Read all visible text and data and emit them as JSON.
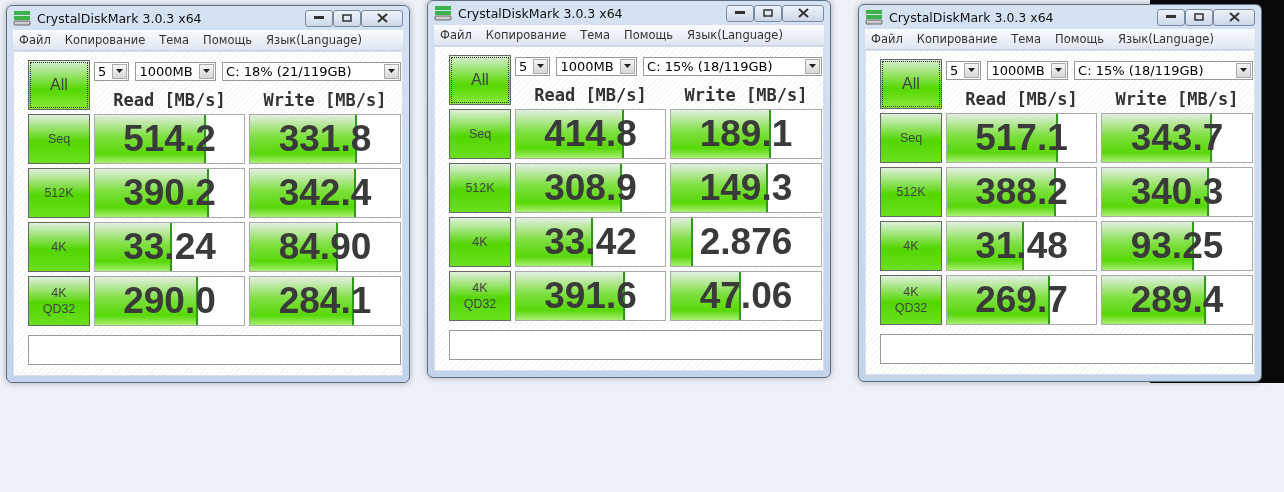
{
  "windows": [
    {
      "title": "CrystalDiskMark 3.0.3 x64",
      "menu": [
        "Файл",
        "Копирование",
        "Тема",
        "Помощь",
        "Язык(Language)"
      ],
      "all_button": "All",
      "count": "5",
      "size": "1000MB",
      "drive": "C: 18% (21/119GB)",
      "headers": [
        "Read [MB/s]",
        "Write [MB/s]"
      ],
      "rows": [
        {
          "label": "Seq",
          "read": {
            "value": "514.2",
            "level": 0.73
          },
          "write": {
            "value": "331.8",
            "level": 0.7
          }
        },
        {
          "label": "512K",
          "read": {
            "value": "390.2",
            "level": 0.75
          },
          "write": {
            "value": "342.4",
            "level": 0.69
          }
        },
        {
          "label": "4K",
          "read": {
            "value": "33.24",
            "level": 0.5
          },
          "write": {
            "value": "84.90",
            "level": 0.57
          }
        },
        {
          "label": "4K QD32",
          "read": {
            "value": "290.0",
            "level": 0.68
          },
          "write": {
            "value": "284.1",
            "level": 0.68
          }
        }
      ]
    },
    {
      "title": "CrystalDiskMark 3.0.3 x64",
      "menu": [
        "Файл",
        "Копирование",
        "Тема",
        "Помощь",
        "Язык(Language)"
      ],
      "all_button": "All",
      "count": "5",
      "size": "1000MB",
      "drive": "C: 15% (18/119GB)",
      "headers": [
        "Read [MB/s]",
        "Write [MB/s]"
      ],
      "rows": [
        {
          "label": "Seq",
          "read": {
            "value": "414.8",
            "level": 0.71
          },
          "write": {
            "value": "189.1",
            "level": 0.65
          }
        },
        {
          "label": "512K",
          "read": {
            "value": "308.9",
            "level": 0.7
          },
          "write": {
            "value": "149.3",
            "level": 0.63
          }
        },
        {
          "label": "4K",
          "read": {
            "value": "33.42",
            "level": 0.5
          },
          "write": {
            "value": "2.876",
            "level": 0.13
          }
        },
        {
          "label": "4K QD32",
          "read": {
            "value": "391.6",
            "level": 0.72
          },
          "write": {
            "value": "47.06",
            "level": 0.45
          }
        }
      ]
    },
    {
      "title": "CrystalDiskMark 3.0.3 x64",
      "menu": [
        "Файл",
        "Копирование",
        "Тема",
        "Помощь",
        "Язык(Language)"
      ],
      "all_button": "All",
      "count": "5",
      "size": "1000MB",
      "drive": "C: 15% (18/119GB)",
      "headers": [
        "Read [MB/s]",
        "Write [MB/s]"
      ],
      "rows": [
        {
          "label": "Seq",
          "read": {
            "value": "517.1",
            "level": 0.73
          },
          "write": {
            "value": "343.7",
            "level": 0.72
          }
        },
        {
          "label": "512K",
          "read": {
            "value": "388.2",
            "level": 0.72
          },
          "write": {
            "value": "340.3",
            "level": 0.7
          }
        },
        {
          "label": "4K",
          "read": {
            "value": "31.48",
            "level": 0.5
          },
          "write": {
            "value": "93.25",
            "level": 0.6
          }
        },
        {
          "label": "4K QD32",
          "read": {
            "value": "269.7",
            "level": 0.68
          },
          "write": {
            "value": "289.4",
            "level": 0.68
          }
        }
      ]
    }
  ]
}
